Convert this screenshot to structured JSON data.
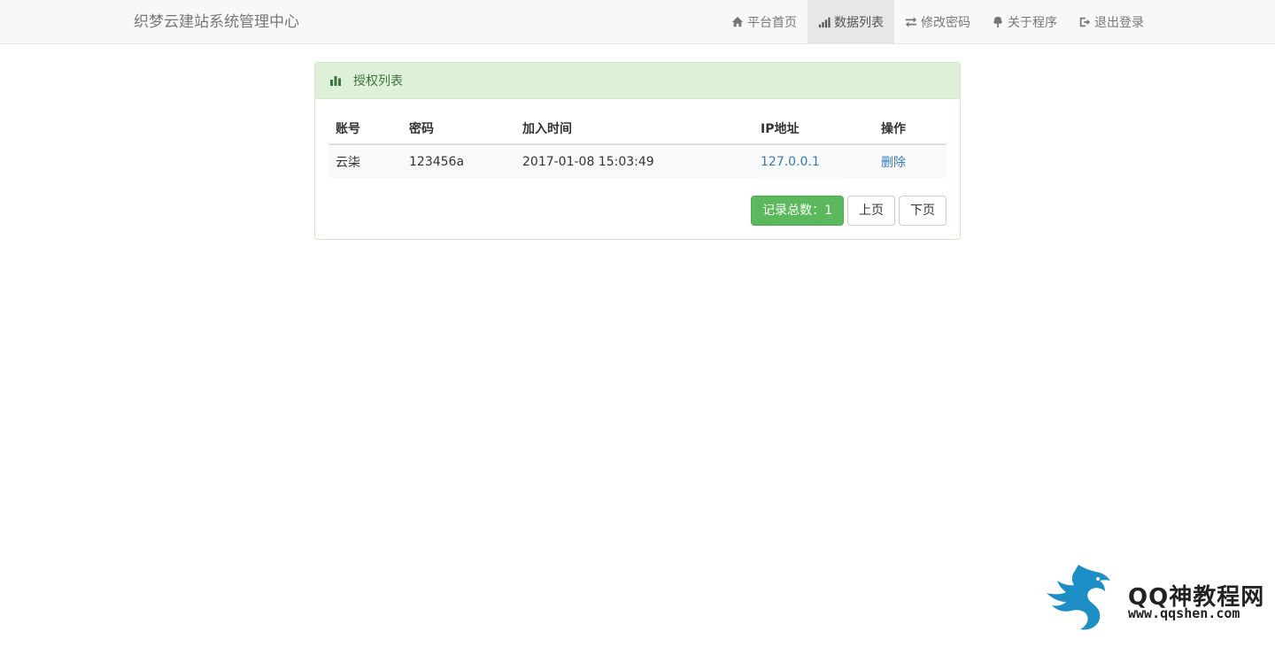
{
  "navbar": {
    "brand": "织梦云建站系统管理中心",
    "items": [
      {
        "label": "平台首页",
        "icon": "home-icon",
        "active": false
      },
      {
        "label": "数据列表",
        "icon": "signal-icon",
        "active": true
      },
      {
        "label": "修改密码",
        "icon": "transfer-icon",
        "active": false
      },
      {
        "label": "关于程序",
        "icon": "tree-icon",
        "active": false
      },
      {
        "label": "退出登录",
        "icon": "logout-icon",
        "active": false
      }
    ]
  },
  "panel": {
    "title": "授权列表",
    "icon": "stats-icon",
    "table": {
      "headers": [
        "账号",
        "密码",
        "加入时间",
        "IP地址",
        "操作"
      ],
      "rows": [
        {
          "account": "云柒",
          "password": "123456a",
          "joined": "2017-01-08 15:03:49",
          "ip": "127.0.0.1",
          "action": "删除"
        }
      ]
    },
    "pager": {
      "count_label": "记录总数：1",
      "prev": "上页",
      "next": "下页"
    }
  },
  "watermark": {
    "title": "QQ神教程网",
    "url": "www.qqshen.com"
  },
  "colors": {
    "panel_header_bg": "#dff0d8",
    "panel_header_text": "#3c763d",
    "success": "#5cb85c",
    "link": "#337ab7",
    "logo_blue": "#1e8fc6"
  }
}
